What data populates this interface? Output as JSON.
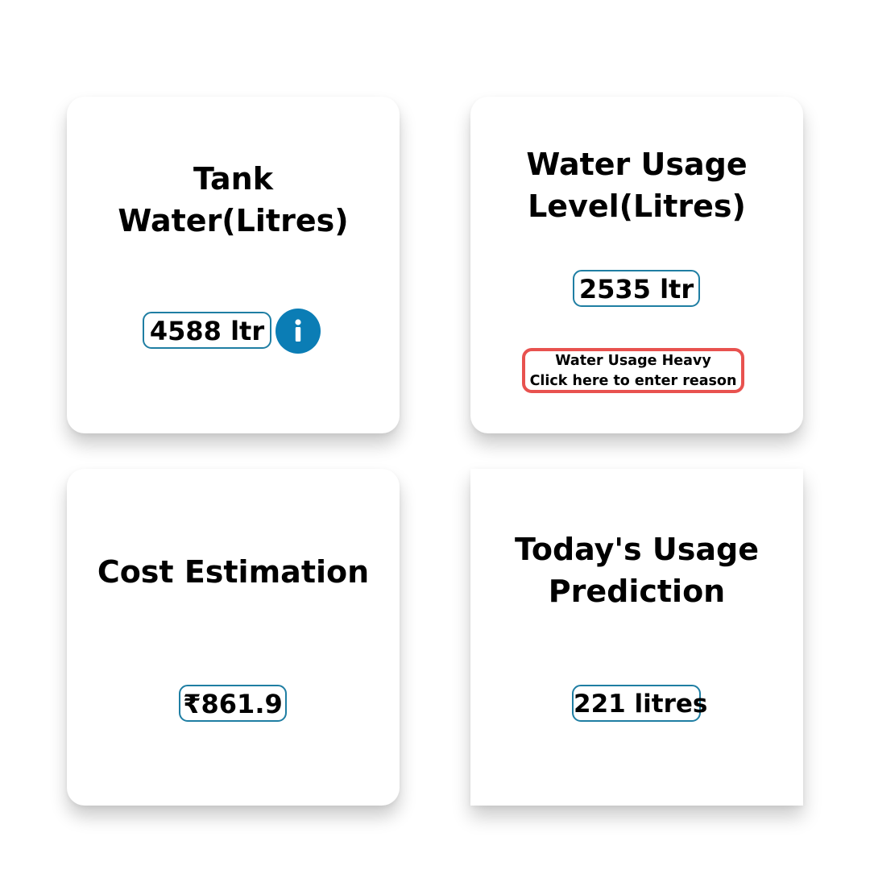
{
  "cards": {
    "tank": {
      "title": "Tank Water(Litres)",
      "value": "4588 ltr",
      "icon": "info-icon"
    },
    "usage": {
      "title": "Water Usage Level(Litres)",
      "value": "2535 ltr",
      "alert_line1": "Water Usage Heavy",
      "alert_line2": "Click here to enter reason"
    },
    "cost": {
      "title": "Cost Estimation",
      "value": "₹861.9"
    },
    "prediction": {
      "title": "Today's Usage Prediction",
      "value": "221 litres"
    }
  },
  "colors": {
    "pill_border": "#1f7ea3",
    "info_icon_bg": "#0b7db5",
    "alert_border": "#e8524f"
  }
}
